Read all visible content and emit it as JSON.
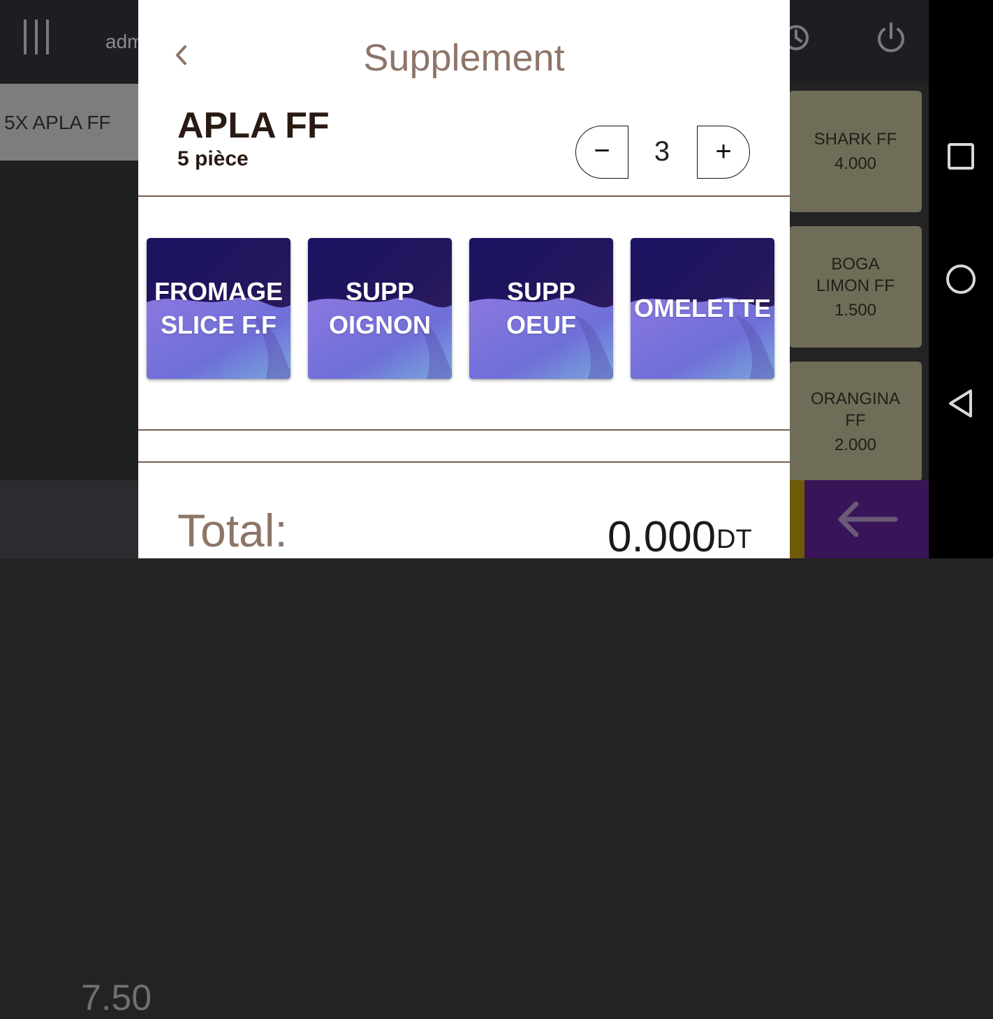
{
  "background": {
    "header": {
      "user_text": "adm"
    },
    "order": {
      "line_label": "5X APLA FF",
      "total": "7.50"
    },
    "products": [
      {
        "name": "SHARK FF",
        "price": "4.000"
      },
      {
        "name": "BOGA LIMON FF",
        "price": "1.500"
      },
      {
        "name": "ORANGINA FF",
        "price": "2.000"
      }
    ],
    "colors": {
      "product_card": "#6f6d57",
      "back_button": "#3a1458",
      "accent_strip": "#6e5a07"
    }
  },
  "modal": {
    "title": "Supplement",
    "product": {
      "name": "APLA FF",
      "subtitle": "5 pièce"
    },
    "quantity": {
      "minus": "−",
      "value": "3",
      "plus": "+"
    },
    "supplements": [
      {
        "label": "FROMAGE SLICE F.F"
      },
      {
        "label": "SUPP OIGNON"
      },
      {
        "label": "SUPP OEUF"
      },
      {
        "label": "OMELETTE"
      }
    ],
    "total": {
      "label": "Total:",
      "value": "0.000",
      "currency": "DT"
    },
    "colors": {
      "title": "#8d7568",
      "divider": "#7c5a4c",
      "tile_dark": "#1b1460",
      "tile_wave": "#6f6fd8"
    }
  },
  "icons": [
    "menu-icon",
    "clock-icon",
    "power-icon",
    "chevron-left-icon",
    "arrow-left-icon",
    "recents-icon",
    "home-icon",
    "back-triangle-icon"
  ]
}
